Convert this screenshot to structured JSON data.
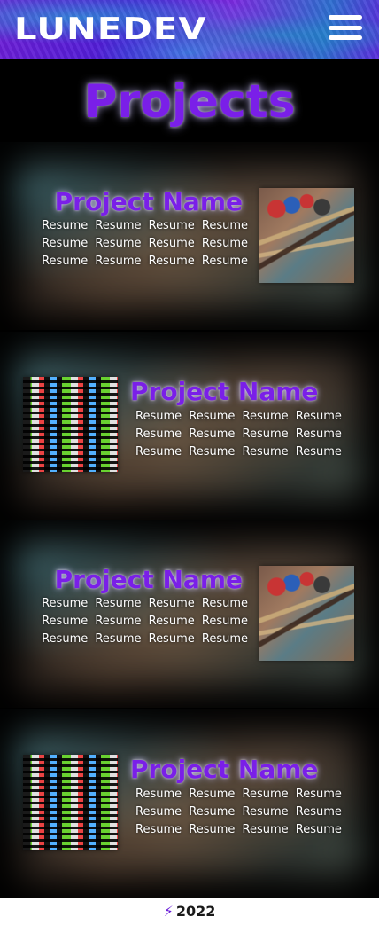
{
  "header": {
    "logo_text": "LUNEDEV",
    "menu_icon": "hamburger-menu-icon"
  },
  "page": {
    "title": "Projects"
  },
  "projects": [
    {
      "title": "Project Name",
      "description": "Resume Resume Resume Resume Resume Resume Resume Resume Resume Resume Resume Resume",
      "image": "paint-brushes-image"
    },
    {
      "title": "Project Name",
      "description": "Resume Resume Resume Resume Resume Resume Resume Resume Resume Resume Resume Resume",
      "image": "code-screen-image"
    },
    {
      "title": "Project Name",
      "description": "Resume Resume Resume Resume Resume Resume Resume Resume Resume Resume Resume Resume",
      "image": "paint-brushes-image"
    },
    {
      "title": "Project Name",
      "description": "Resume Resume Resume Resume Resume Resume Resume Resume Resume Resume Resume Resume",
      "image": "code-screen-image"
    }
  ],
  "footer": {
    "icon": "lightning-logo-icon",
    "year": "2022"
  },
  "colors": {
    "accent": "#7a1fe8",
    "footer_bg": "#ffffff",
    "page_bg": "#000000"
  }
}
